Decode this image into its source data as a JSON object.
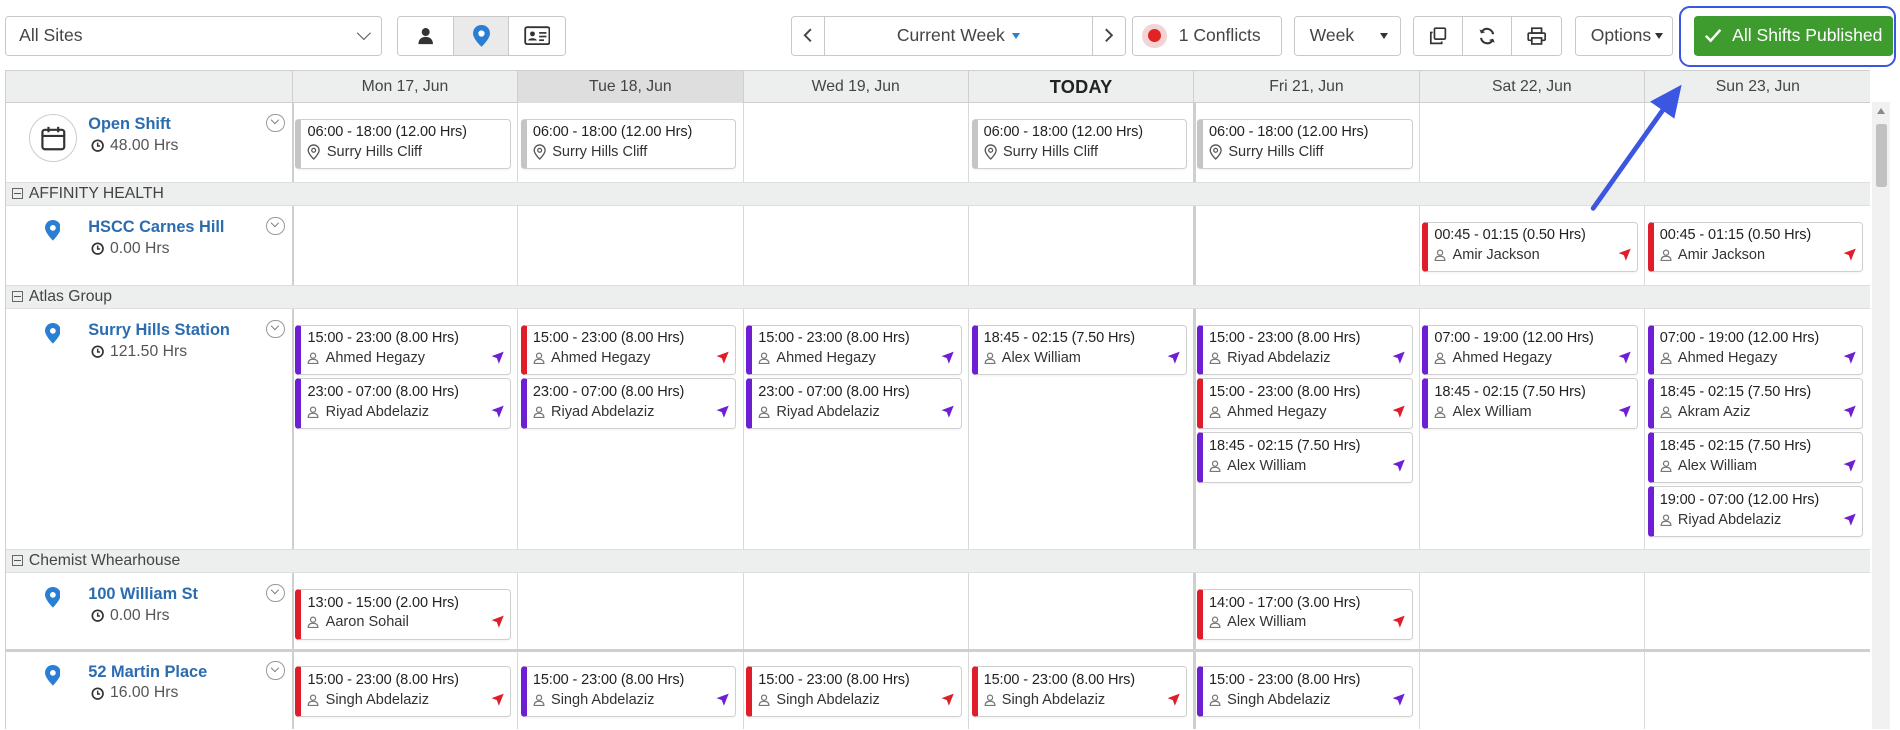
{
  "toolbar": {
    "site_select": "All Sites",
    "week_label": "Current Week",
    "conflicts": "1 Conflicts",
    "view_select": "Week",
    "options": "Options",
    "publish": "All Shifts Published",
    "icons": [
      "person-icon",
      "location-pin-icon",
      "id-card-icon",
      "copy-icon",
      "refresh-icon",
      "print-icon",
      "chevron-left-icon",
      "chevron-right-icon",
      "check-icon"
    ]
  },
  "days": [
    "Mon 17, Jun",
    "Tue 18, Jun",
    "Wed 19, Jun",
    "TODAY",
    "Fri 21, Jun",
    "Sat 22, Jun",
    "Sun 23, Jun"
  ],
  "open_shift": {
    "name": "Open Shift",
    "hours": "48.00 Hrs",
    "shifts": [
      {
        "day": 0,
        "time": "06:00 - 18:00 (12.00 Hrs)",
        "who": "Surry Hills Cliff"
      },
      {
        "day": 1,
        "time": "06:00 - 18:00 (12.00 Hrs)",
        "who": "Surry Hills Cliff"
      },
      {
        "day": 3,
        "time": "06:00 - 18:00 (12.00 Hrs)",
        "who": "Surry Hills Cliff"
      },
      {
        "day": 4,
        "time": "06:00 - 18:00 (12.00 Hrs)",
        "who": "Surry Hills Cliff"
      }
    ]
  },
  "groups": [
    {
      "title": "AFFINITY HEALTH",
      "sites": [
        {
          "name": "HSCC Carnes Hill",
          "hours": "0.00 Hrs",
          "shifts": [
            {
              "day": 5,
              "slot": 0,
              "time": "00:45 - 01:15 (0.50 Hrs)",
              "who": "Amir Jackson",
              "status": "red"
            },
            {
              "day": 6,
              "slot": 0,
              "time": "00:45 - 01:15 (0.50 Hrs)",
              "who": "Amir Jackson",
              "status": "red"
            }
          ]
        }
      ]
    },
    {
      "title": "Atlas Group",
      "sites": [
        {
          "name": "Surry Hills Station",
          "hours": "121.50 Hrs",
          "shifts": [
            {
              "day": 0,
              "slot": 0,
              "time": "15:00 - 23:00 (8.00 Hrs)",
              "who": "Ahmed Hegazy",
              "status": "purple"
            },
            {
              "day": 0,
              "slot": 1,
              "time": "23:00 - 07:00 (8.00 Hrs)",
              "who": "Riyad Abdelaziz",
              "status": "purple"
            },
            {
              "day": 1,
              "slot": 0,
              "time": "15:00 - 23:00 (8.00 Hrs)",
              "who": "Ahmed Hegazy",
              "status": "red"
            },
            {
              "day": 1,
              "slot": 1,
              "time": "23:00 - 07:00 (8.00 Hrs)",
              "who": "Riyad Abdelaziz",
              "status": "purple"
            },
            {
              "day": 2,
              "slot": 0,
              "time": "15:00 - 23:00 (8.00 Hrs)",
              "who": "Ahmed Hegazy",
              "status": "purple"
            },
            {
              "day": 2,
              "slot": 1,
              "time": "23:00 - 07:00 (8.00 Hrs)",
              "who": "Riyad Abdelaziz",
              "status": "purple"
            },
            {
              "day": 3,
              "slot": 0,
              "time": "18:45 - 02:15 (7.50 Hrs)",
              "who": "Alex William",
              "status": "purple"
            },
            {
              "day": 4,
              "slot": 0,
              "time": "15:00 - 23:00 (8.00 Hrs)",
              "who": "Riyad Abdelaziz",
              "status": "purple"
            },
            {
              "day": 4,
              "slot": 1,
              "time": "15:00 - 23:00 (8.00 Hrs)",
              "who": "Ahmed Hegazy",
              "status": "red"
            },
            {
              "day": 4,
              "slot": 2,
              "time": "18:45 - 02:15 (7.50 Hrs)",
              "who": "Alex William",
              "status": "purple"
            },
            {
              "day": 5,
              "slot": 0,
              "time": "07:00 - 19:00 (12.00 Hrs)",
              "who": "Ahmed Hegazy",
              "status": "purple"
            },
            {
              "day": 5,
              "slot": 1,
              "time": "18:45 - 02:15 (7.50 Hrs)",
              "who": "Alex William",
              "status": "purple"
            },
            {
              "day": 6,
              "slot": 0,
              "time": "07:00 - 19:00 (12.00 Hrs)",
              "who": "Ahmed Hegazy",
              "status": "purple"
            },
            {
              "day": 6,
              "slot": 1,
              "time": "18:45 - 02:15 (7.50 Hrs)",
              "who": "Akram Aziz",
              "status": "purple"
            },
            {
              "day": 6,
              "slot": 2,
              "time": "18:45 - 02:15 (7.50 Hrs)",
              "who": "Alex William",
              "status": "purple"
            },
            {
              "day": 6,
              "slot": 3,
              "time": "19:00 - 07:00 (12.00 Hrs)",
              "who": "Riyad Abdelaziz",
              "status": "purple"
            }
          ]
        }
      ]
    },
    {
      "title": "Chemist Whearhouse",
      "sites": [
        {
          "name": "100 William St",
          "hours": "0.00 Hrs",
          "shifts": [
            {
              "day": 0,
              "slot": 0,
              "time": "13:00 - 15:00 (2.00 Hrs)",
              "who": "Aaron Sohail",
              "status": "red"
            },
            {
              "day": 4,
              "slot": 0,
              "time": "14:00 - 17:00 (3.00 Hrs)",
              "who": "Alex William",
              "status": "red"
            }
          ]
        },
        {
          "name": "52 Martin Place",
          "hours": "16.00 Hrs",
          "shifts": [
            {
              "day": 0,
              "slot": 0,
              "time": "15:00 - 23:00 (8.00 Hrs)",
              "who": "Singh Abdelaziz",
              "status": "red"
            },
            {
              "day": 1,
              "slot": 0,
              "time": "15:00 - 23:00 (8.00 Hrs)",
              "who": "Singh Abdelaziz",
              "status": "purple"
            },
            {
              "day": 2,
              "slot": 0,
              "time": "15:00 - 23:00 (8.00 Hrs)",
              "who": "Singh Abdelaziz",
              "status": "red"
            },
            {
              "day": 3,
              "slot": 0,
              "time": "15:00 - 23:00 (8.00 Hrs)",
              "who": "Singh Abdelaziz",
              "status": "red"
            },
            {
              "day": 4,
              "slot": 0,
              "time": "15:00 - 23:00 (8.00 Hrs)",
              "who": "Singh Abdelaziz",
              "status": "purple"
            }
          ]
        }
      ]
    }
  ],
  "colors": {
    "publish": "#3e9c2f",
    "link": "#2b6cb0",
    "status_red": "#e01e2b",
    "status_purple": "#6e1fd4",
    "open_gray": "#c5c5c5",
    "annotation": "#3b56e0"
  }
}
